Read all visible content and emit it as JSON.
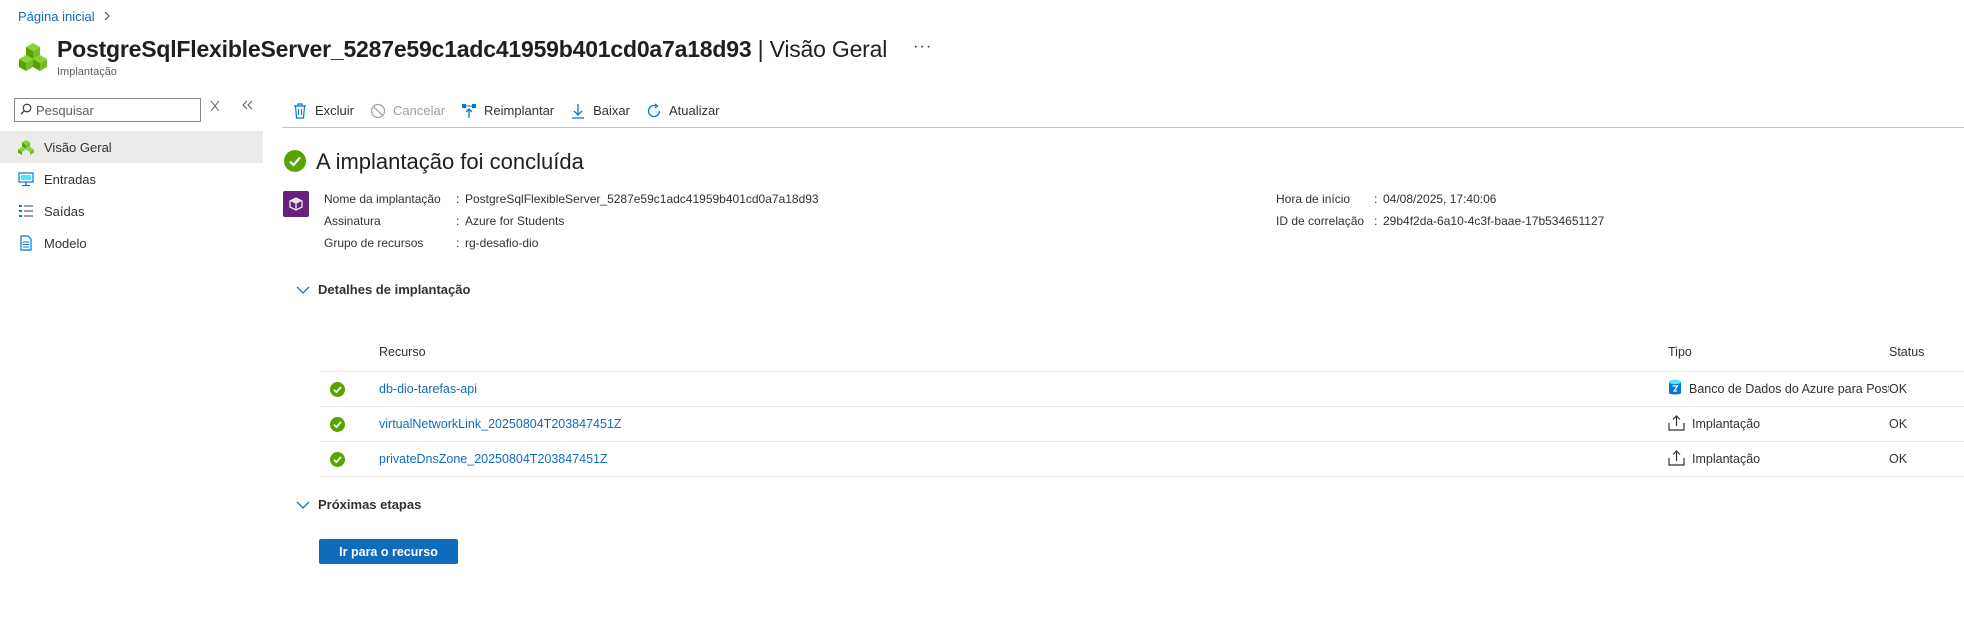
{
  "breadcrumb": {
    "home": "Página inicial"
  },
  "header": {
    "resource_name": "PostgreSqlFlexibleServer_5287e59c1adc41959b401cd0a7a18d93",
    "page_suffix": " | Visão Geral",
    "subtitle": "Implantação",
    "more_label": "···"
  },
  "search": {
    "placeholder": "Pesquisar"
  },
  "sidebar": {
    "items": [
      {
        "label": "Visão Geral",
        "icon": "overview-icon",
        "active": true
      },
      {
        "label": "Entradas",
        "icon": "inputs-icon"
      },
      {
        "label": "Saídas",
        "icon": "outputs-icon"
      },
      {
        "label": "Modelo",
        "icon": "template-icon"
      }
    ]
  },
  "toolbar": {
    "delete": "Excluir",
    "cancel": "Cancelar",
    "redeploy": "Reimplantar",
    "download": "Baixar",
    "refresh": "Atualizar"
  },
  "status": {
    "heading": "A implantação foi concluída"
  },
  "details": {
    "left": [
      {
        "label": "Nome da implantação",
        "value": "PostgreSqlFlexibleServer_5287e59c1adc41959b401cd0a7a18d93"
      },
      {
        "label": "Assinatura",
        "value": "Azure for Students"
      },
      {
        "label": "Grupo de recursos",
        "value": "rg-desafio-dio"
      }
    ],
    "right": [
      {
        "label": "Hora de início",
        "value": "04/08/2025, 17:40:06"
      },
      {
        "label": "ID de correlação",
        "value": "29b4f2da-6a10-4c3f-baae-17b534651127"
      }
    ],
    "separator": ":"
  },
  "sections": {
    "deployment_details": "Detalhes de implantação",
    "next_steps": "Próximas etapas"
  },
  "table": {
    "headers": {
      "resource": "Recurso",
      "type": "Tipo",
      "status": "Status"
    },
    "rows": [
      {
        "resource": "db-dio-tarefas-api",
        "type": "Banco de Dados do Azure para PostgreSQL",
        "status": "OK"
      },
      {
        "resource": "virtualNetworkLink_20250804T203847451Z",
        "type": "Implantação",
        "status": "OK"
      },
      {
        "resource": "privateDnsZone_20250804T203847451Z",
        "type": "Implantação",
        "status": "OK"
      }
    ]
  },
  "actions": {
    "go_to_resource": "Ir para o recurso"
  },
  "colors": {
    "accent": "#0f6cbd",
    "success": "#57a300",
    "deploy_purple": "#68217a"
  }
}
